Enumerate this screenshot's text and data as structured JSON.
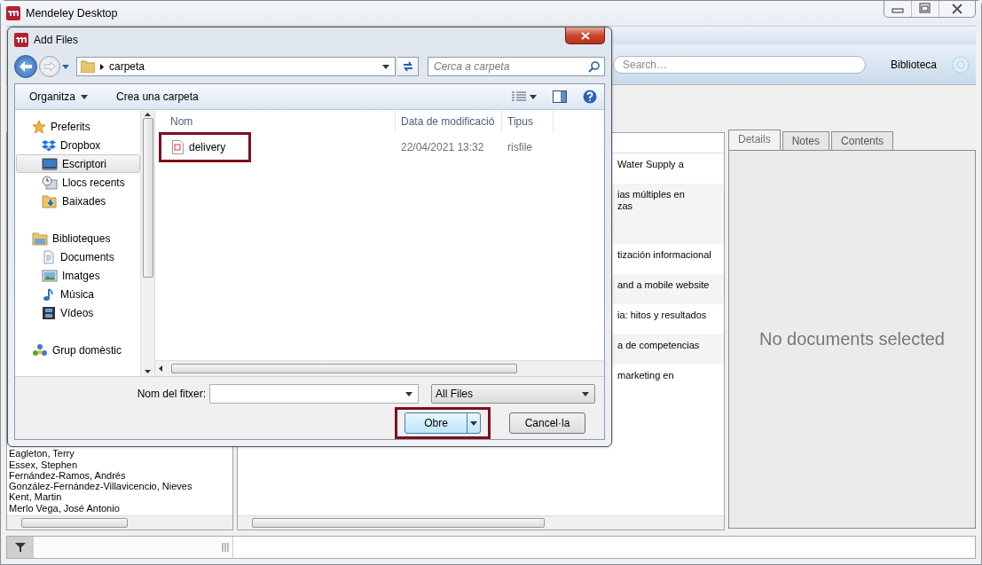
{
  "app_window": {
    "title": "Mendeley Desktop",
    "search": {
      "placeholder": "Search…"
    },
    "library_label": "Biblioteca",
    "authors": [
      "Eagleton, Terry",
      "Essex, Stephen",
      "Fernández-Ramos, Andrés",
      "González-Fernández-Villavicencio, Nieves",
      "Kent, Martin",
      "Merlo Vega, José Antonio"
    ],
    "documents": [
      {
        "lines": [
          "Water Supply a"
        ]
      },
      {
        "lines": [
          "ias múltiples en",
          "zas"
        ]
      },
      {
        "lines": [
          "tización informacional"
        ]
      },
      {
        "lines": [
          "and a mobile website"
        ]
      },
      {
        "lines": [
          "ia: hitos y resultados"
        ]
      },
      {
        "lines": [
          "a de competencias"
        ]
      },
      {
        "lines": [
          "marketing en"
        ]
      }
    ],
    "detail_tabs": [
      {
        "label": "Details",
        "selected": true
      },
      {
        "label": "Notes",
        "selected": false
      },
      {
        "label": "Contents",
        "selected": false
      }
    ],
    "empty_message": "No documents selected"
  },
  "dialog": {
    "title": "Add Files",
    "breadcrumb": "carpeta",
    "search": {
      "placeholder": "Cerca a carpeta"
    },
    "toolbar": [
      {
        "label": "Organitza",
        "kind": "menu"
      },
      {
        "label": "Crea una carpeta",
        "kind": "plain"
      }
    ],
    "navigation": [
      {
        "label": "Preferits",
        "kind": "star",
        "selected": false,
        "children": [
          {
            "label": "Dropbox",
            "kind": "dropbox",
            "selected": false
          },
          {
            "label": "Escriptori",
            "kind": "desktop",
            "selected": true
          },
          {
            "label": "Llocs recents",
            "kind": "recent",
            "selected": false
          },
          {
            "label": "Baixades",
            "kind": "downloads",
            "selected": false
          }
        ]
      },
      {
        "label": "Biblioteques",
        "kind": "libraries",
        "selected": false,
        "children": [
          {
            "label": "Documents",
            "kind": "document",
            "selected": false
          },
          {
            "label": "Imatges",
            "kind": "image",
            "selected": false
          },
          {
            "label": "Música",
            "kind": "music",
            "selected": false
          },
          {
            "label": "Vídeos",
            "kind": "video",
            "selected": false
          }
        ]
      },
      {
        "label": "Grup domèstic",
        "kind": "homegroup",
        "selected": false
      }
    ],
    "columns": [
      "Nom",
      "Data de modificació",
      "Tipus"
    ],
    "files": [
      {
        "name": "delivery",
        "modified": "22/04/2021 13:32",
        "type": "risfile",
        "highlighted": true
      }
    ],
    "filename_label": "Nom del fitxer:",
    "filter": "All Files",
    "buttons": [
      {
        "label": "Obre",
        "kind": "split",
        "highlighted": true
      },
      {
        "label": "Cancel·la",
        "kind": "plain",
        "highlighted": false
      }
    ]
  }
}
